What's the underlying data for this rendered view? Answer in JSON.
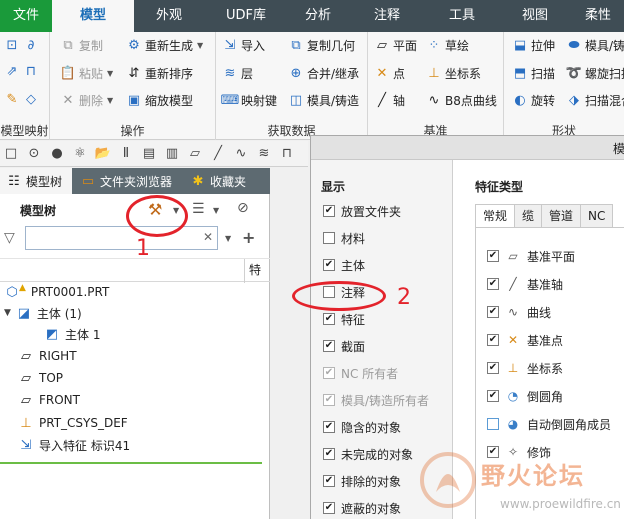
{
  "ribbon": {
    "tabs": [
      "文件",
      "模型",
      "外观",
      "UDF库",
      "分析",
      "注释",
      "工具",
      "视图",
      "柔性"
    ],
    "groups": {
      "model_intent": "模型映射",
      "operations": "操作",
      "get_data": "获取数据",
      "datum": "基准",
      "shapes": "形状"
    },
    "items": {
      "copy": "复制",
      "paste": "粘贴",
      "delete": "删除",
      "regenerate": "重新生成",
      "reorder": "重新排序",
      "shrinkwrap": "缩放模型",
      "import": "导入",
      "layer": "层",
      "mapkey": "映射键",
      "copy_geom": "复制几何",
      "merge": "合并/继承",
      "mold_cast": "模具/铸造",
      "plane": "平面",
      "sketch": "草绘",
      "point": "点",
      "csys": "坐标系",
      "axis": "轴",
      "curve": "B8点曲线",
      "extrude": "拉伸",
      "mold_shape": "模具/铸",
      "sweep": "扫描",
      "helical": "螺旋扫描",
      "revolve": "旋转",
      "swept_blend": "扫描混合"
    }
  },
  "left_panel": {
    "tabs": [
      "模型树",
      "文件夹浏览器",
      "收藏夹"
    ],
    "tree_title": "模型树",
    "search_value": "",
    "column_header": "特",
    "nodes": [
      "PRT0001.PRT",
      "主体 (1)",
      "主体 1",
      "RIGHT",
      "TOP",
      "FRONT",
      "PRT_CSYS_DEF",
      "导入特征 标识41"
    ]
  },
  "dialog": {
    "title": "模",
    "display_header": "显示",
    "display_items": [
      {
        "label": "放置文件夹",
        "checked": true,
        "disabled": false
      },
      {
        "label": "材料",
        "checked": false,
        "disabled": false
      },
      {
        "label": "主体",
        "checked": true,
        "disabled": false
      },
      {
        "label": "注释",
        "checked": false,
        "disabled": false
      },
      {
        "label": "特征",
        "checked": true,
        "disabled": false
      },
      {
        "label": "截面",
        "checked": true,
        "disabled": false
      },
      {
        "label": "NC 所有者",
        "checked": true,
        "disabled": true
      },
      {
        "label": "模具/铸造所有者",
        "checked": true,
        "disabled": true
      },
      {
        "label": "隐含的对象",
        "checked": true,
        "disabled": false
      },
      {
        "label": "未完成的对象",
        "checked": true,
        "disabled": false
      },
      {
        "label": "排除的对象",
        "checked": true,
        "disabled": false
      },
      {
        "label": "遮蔽的对象",
        "checked": true,
        "disabled": false
      }
    ],
    "feature_types_header": "特征类型",
    "feature_tabs": [
      "常规",
      "缆",
      "管道",
      "NC"
    ],
    "feature_items": [
      {
        "label": "基准平面",
        "checked": true,
        "icon": "datum-plane-icon"
      },
      {
        "label": "基准轴",
        "checked": true,
        "icon": "datum-axis-icon"
      },
      {
        "label": "曲线",
        "checked": true,
        "icon": "curve-icon"
      },
      {
        "label": "基准点",
        "checked": true,
        "icon": "datum-point-icon"
      },
      {
        "label": "坐标系",
        "checked": true,
        "icon": "csys-icon"
      },
      {
        "label": "倒圆角",
        "checked": true,
        "icon": "round-icon"
      },
      {
        "label": "自动倒圆角成员",
        "checked": false,
        "icon": "auto-round-icon"
      },
      {
        "label": "修饰",
        "checked": true,
        "icon": "cosmetic-icon"
      }
    ]
  },
  "annotations": {
    "marker_1": "1",
    "marker_2": "2",
    "accent_color": "#e3232b"
  },
  "watermark": {
    "title": "野火论坛",
    "url": "www.proewildfire.cn"
  }
}
